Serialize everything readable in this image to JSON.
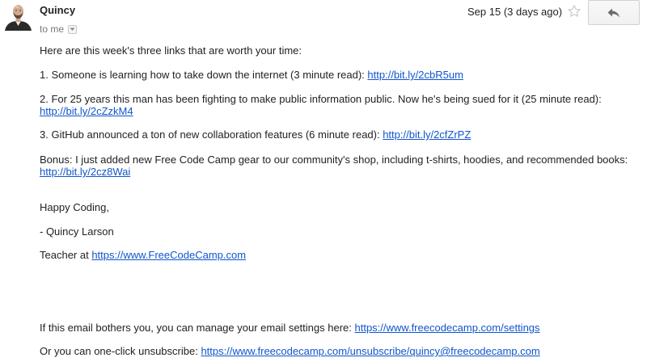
{
  "header": {
    "sender": "Quincy",
    "recipient": "to me",
    "date": "Sep 15 (3 days ago)",
    "avatar_icon": "profile-photo",
    "star_icon": "star-outline-icon",
    "reply_icon": "reply-arrow-icon",
    "details_icon": "chevron-down-icon"
  },
  "body": {
    "intro": "Here are this week's three links that are worth your time:",
    "item1_text": "1. Someone is learning how to take down the internet (3 minute read): ",
    "item1_link": "http://bit.ly/2cbR5um",
    "item2_text": "2. For 25 years this man has been fighting to make public information public. Now he's being sued for it (25 minute read):",
    "item2_link": "http://bit.ly/2cZzkM4",
    "item3_text": "3. GitHub announced a ton of new collaboration features (6 minute read): ",
    "item3_link": "http://bit.ly/2cfZrPZ",
    "bonus_text": "Bonus: I just added new Free Code Camp gear to our community's shop, including t-shirts, hoodies, and recommended books:",
    "bonus_link": "http://bit.ly/2cz8Wai",
    "greeting": "Happy Coding,",
    "signature": "- Quincy Larson",
    "teacher_text": "Teacher at ",
    "teacher_link": "https://www.FreeCodeCamp.com",
    "settings_text": "If this email bothers you, you can manage your email settings here: ",
    "settings_link": "https://www.freecodecamp.com/settings",
    "unsubscribe_text": "Or you can one-click unsubscribe: ",
    "unsubscribe_link": "https://www.freecodecamp.com/unsubscribe/quincy@freecodecamp.com"
  },
  "colors": {
    "link": "#1155cc",
    "text": "#222222",
    "secondary_text": "#777777"
  }
}
